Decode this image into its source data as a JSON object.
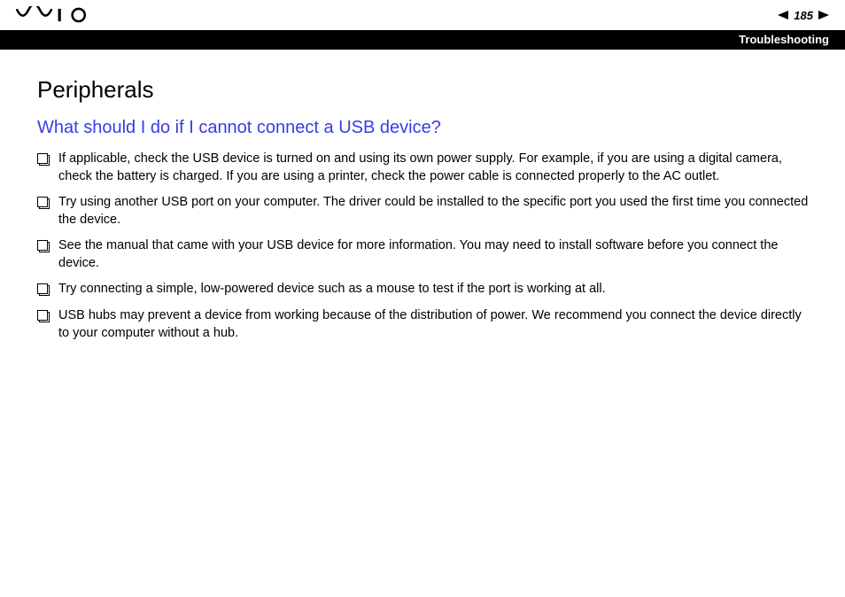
{
  "header": {
    "page_number": "185",
    "section_label": "Troubleshooting"
  },
  "content": {
    "section_title": "Peripherals",
    "question": "What should I do if I cannot connect a USB device?",
    "bullets": [
      "If applicable, check the USB device is turned on and using its own power supply. For example, if you are using a digital camera, check the battery is charged. If you are using a printer, check the power cable is connected properly to the AC outlet.",
      "Try using another USB port on your computer. The driver could be installed to the specific port you used the first time you connected the device.",
      "See the manual that came with your USB device for more information. You may need to install software before you connect the device.",
      "Try connecting a simple, low-powered device such as a mouse to test if the port is working at all.",
      "USB hubs may prevent a device from working because of the distribution of power. We recommend you connect the device directly to your computer without a hub."
    ]
  }
}
